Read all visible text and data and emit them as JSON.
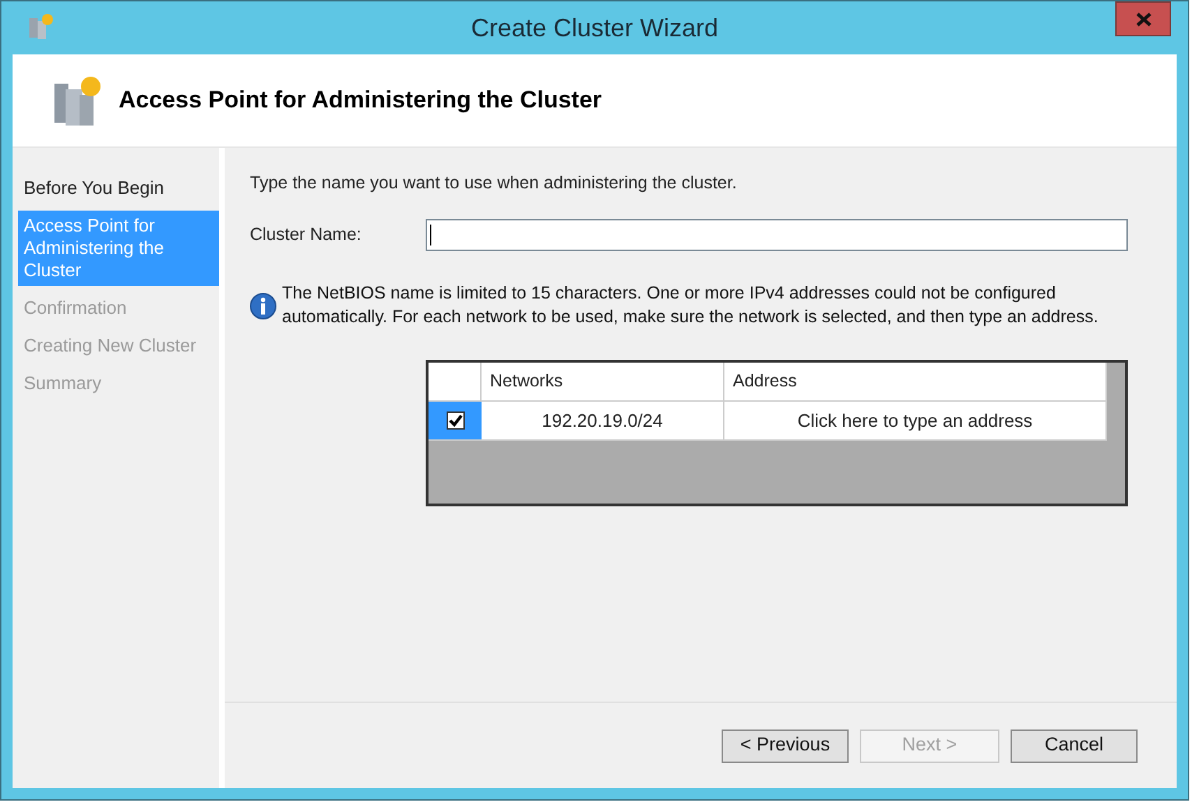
{
  "window": {
    "title": "Create Cluster Wizard"
  },
  "header": {
    "title": "Access Point for Administering the Cluster"
  },
  "steps": [
    {
      "label": "Before You Begin",
      "selected": false,
      "disabled": false
    },
    {
      "label": "Access Point for Administering the Cluster",
      "selected": true,
      "disabled": false
    },
    {
      "label": "Confirmation",
      "selected": false,
      "disabled": true
    },
    {
      "label": "Creating New Cluster",
      "selected": false,
      "disabled": true
    },
    {
      "label": "Summary",
      "selected": false,
      "disabled": true
    }
  ],
  "instruction": "Type the name you want to use when administering the cluster.",
  "cluster_name": {
    "label": "Cluster Name:"
  },
  "info": "The NetBIOS name is limited to 15 characters.  One or more IPv4 addresses could not be configured automatically.  For each network to be used, make sure the network is selected, and then type an address.",
  "table": {
    "columns": [
      "Networks",
      "Address"
    ],
    "rows": [
      {
        "checked": true,
        "selected": true,
        "network": "192.20.19.0/24",
        "address": "Click here to type an address"
      }
    ]
  },
  "buttons": [
    {
      "label": "< Previous",
      "disabled": false
    },
    {
      "label": "Next >",
      "disabled": true
    },
    {
      "label": "Cancel",
      "disabled": false
    }
  ]
}
